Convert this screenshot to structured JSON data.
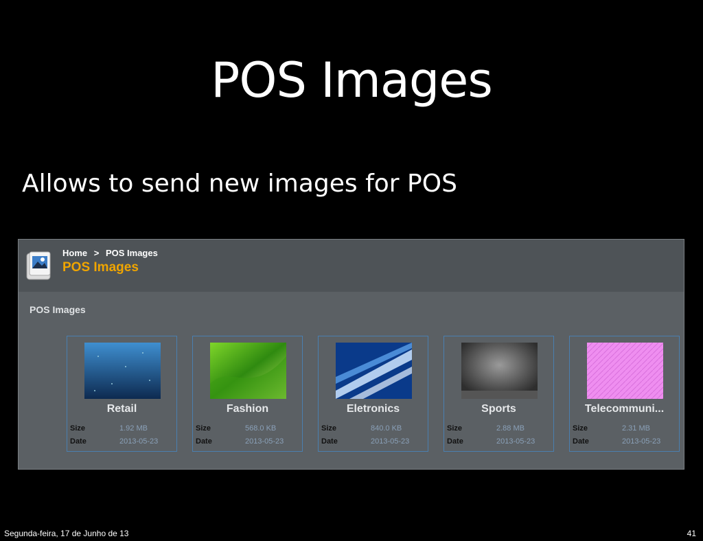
{
  "slide": {
    "title": "POS Images",
    "subtitle": "Allows to send new images for POS",
    "footer_date": "Segunda-feira, 17 de Junho de 13",
    "page_number": "41"
  },
  "app": {
    "breadcrumb": [
      "Home",
      ">",
      "POS Images"
    ],
    "page_title": "POS Images",
    "section_title": "POS Images",
    "size_label": "Size",
    "date_label": "Date",
    "colors": {
      "title": "#f0a500",
      "panel": "#5b6064",
      "card_border": "#4a7fb0"
    },
    "cards": [
      {
        "name": "Retail",
        "size": "1.92 MB",
        "date": "2013-05-23",
        "thumb": "blue-dots"
      },
      {
        "name": "Fashion",
        "size": "568.0 KB",
        "date": "2013-05-23",
        "thumb": "green-wave"
      },
      {
        "name": "Eletronics",
        "size": "840.0 KB",
        "date": "2013-05-23",
        "thumb": "blue-streaks"
      },
      {
        "name": "Sports",
        "size": "2.88 MB",
        "date": "2013-05-23",
        "thumb": "gray-spotlight"
      },
      {
        "name": "Telecommuni...",
        "size": "2.31 MB",
        "date": "2013-05-23",
        "thumb": "pink-pattern"
      }
    ]
  }
}
